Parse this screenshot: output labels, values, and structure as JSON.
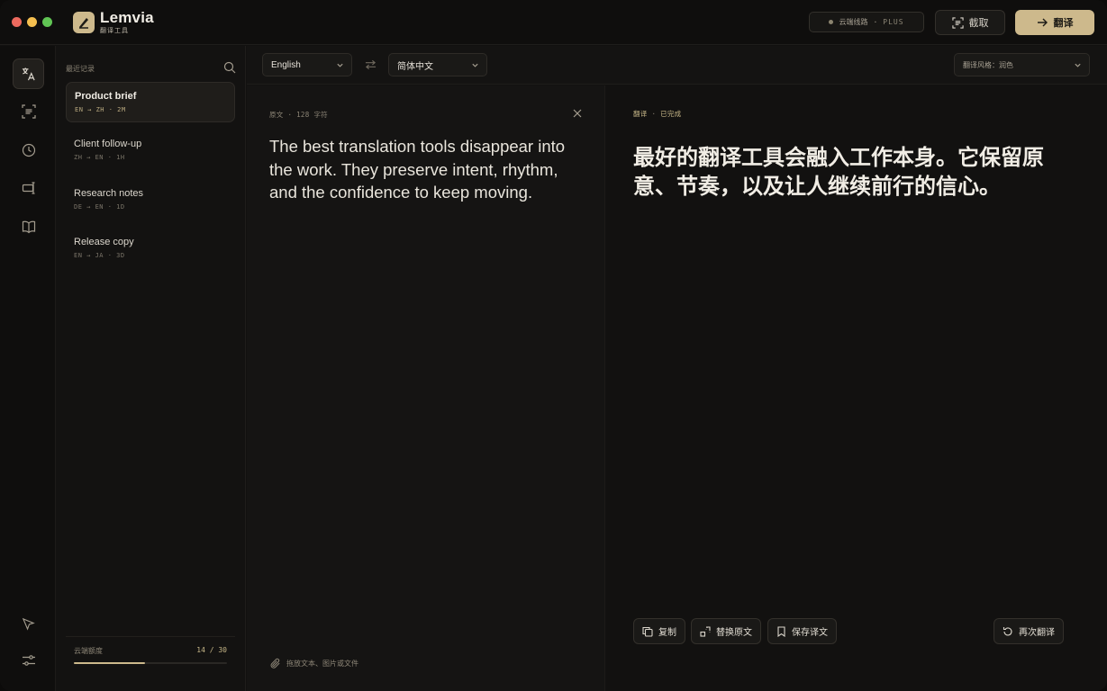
{
  "app": {
    "name": "Lemvia",
    "subtitle": "翻译工具"
  },
  "titlebar": {
    "cloud_status": "云端线路",
    "cloud_plan": "PLUS",
    "capture_label": "截取",
    "translate_label": "翻译"
  },
  "rail": {
    "icons": [
      "translate-icon",
      "scan-text-icon",
      "history-icon",
      "text-cursor-icon",
      "book-icon",
      "pointer-icon",
      "settings-sliders-icon"
    ]
  },
  "sidebar": {
    "title": "最近记录",
    "items": [
      {
        "name": "Product brief",
        "meta": "EN → ZH · 2M"
      },
      {
        "name": "Client follow-up",
        "meta": "ZH → EN · 1H"
      },
      {
        "name": "Research notes",
        "meta": "DE → EN · 1D"
      },
      {
        "name": "Release copy",
        "meta": "EN → JA · 3D"
      }
    ],
    "quota": {
      "label": "云端额度",
      "count": "14 / 30",
      "used": 14,
      "total": 30
    }
  },
  "languages": {
    "source": "English",
    "target": "简体中文",
    "style": "翻译风格：润色"
  },
  "source_pane": {
    "label": "原文",
    "char_count": "128 字符",
    "text": "The best translation tools disappear into the work. They preserve intent, rhythm, and the confidence to keep moving.",
    "drop_hint": "拖放文本、图片或文件"
  },
  "target_pane": {
    "label": "翻译",
    "status": "已完成",
    "text": "最好的翻译工具会融入工作本身。它保留原意、节奏，以及让人继续前行的信心。",
    "actions": {
      "copy": "复制",
      "replace": "替换原文",
      "save": "保存译文",
      "retranslate": "再次翻译"
    }
  },
  "colors": {
    "accent": "#cdb98c",
    "background": "#121110"
  }
}
